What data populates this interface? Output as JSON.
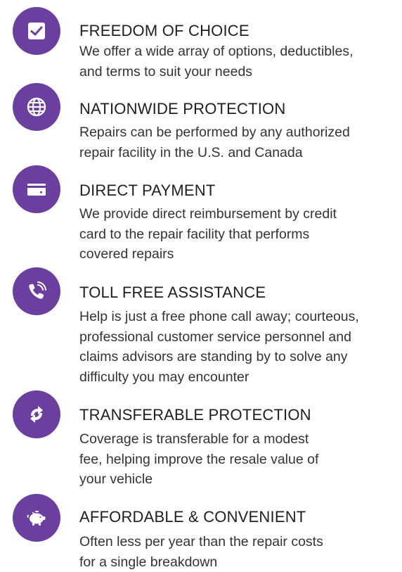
{
  "colors": {
    "accent": "#6a3fa0",
    "icon_foreground": "#ffffff",
    "text": "#333333"
  },
  "features": [
    {
      "icon": "checkbox-icon",
      "title": "FREEDOM OF CHOICE",
      "lines": [
        "We offer a wide array of options, deductibles,",
        "and terms to suit your needs"
      ]
    },
    {
      "icon": "globe-icon",
      "title": "NATIONWIDE PROTECTION",
      "lines": [
        "Repairs can be performed by any authorized",
        "repair facility in the U.S. and Canada"
      ]
    },
    {
      "icon": "credit-card-icon",
      "title": "DIRECT PAYMENT",
      "lines": [
        "We provide direct reimbursement by credit",
        "card to the repair facility that performs",
        "covered repairs"
      ]
    },
    {
      "icon": "phone-icon",
      "title": "TOLL FREE ASSISTANCE",
      "lines": [
        "Help is just a free phone call away; courteous,",
        "professional customer service personnel and",
        "claims advisors are standing by to solve any",
        "difficulty you may encounter"
      ]
    },
    {
      "icon": "transfer-arrows-icon",
      "title": "TRANSFERABLE PROTECTION",
      "lines": [
        "Coverage is transferable for a modest",
        "fee, helping improve the resale value of",
        "your vehicle"
      ]
    },
    {
      "icon": "piggy-bank-icon",
      "title": "AFFORDABLE & CONVENIENT",
      "lines": [
        "Often less per year than the repair costs",
        "for a single breakdown"
      ]
    }
  ]
}
